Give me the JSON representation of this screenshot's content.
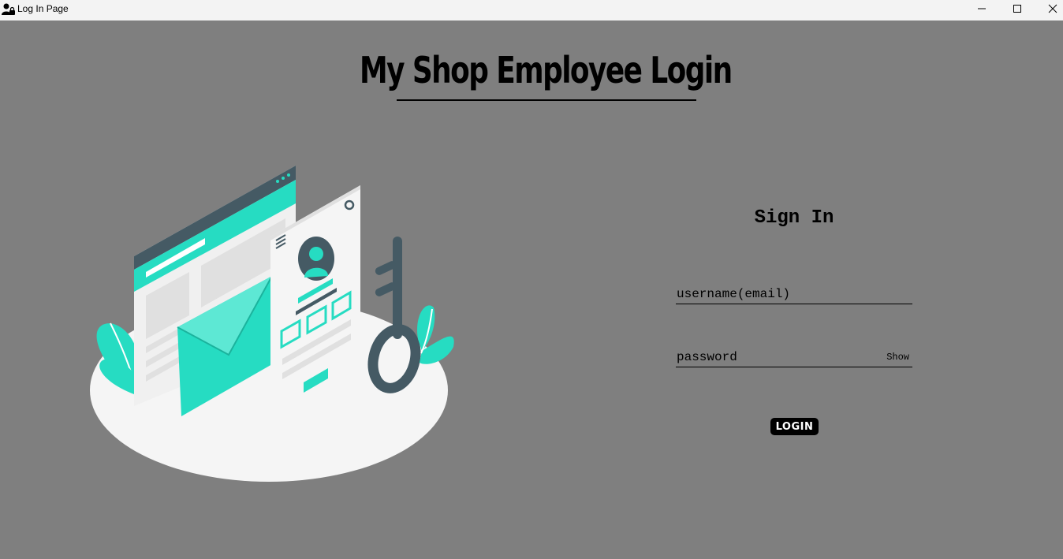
{
  "window": {
    "title": "Log In Page",
    "icon": "user-lock-icon",
    "controls": {
      "minimize": "minimize-icon",
      "maximize": "maximize-icon",
      "close": "close-icon"
    }
  },
  "header": {
    "title": "My Shop Employee Login"
  },
  "illustration": {
    "description_icon": "login-illustration",
    "colors": {
      "accent": "#26dcc2",
      "dark": "#455a64",
      "light": "#f5f5f5",
      "gray": "#e0e0e0"
    }
  },
  "signin": {
    "title": "Sign In",
    "username_placeholder": "username(email)",
    "password_placeholder": "password",
    "show_label": "Show",
    "login_label": "LOGIN"
  },
  "colors": {
    "background": "#7f7f7f",
    "titlebar": "#f3f3f3",
    "text": "#000000"
  }
}
